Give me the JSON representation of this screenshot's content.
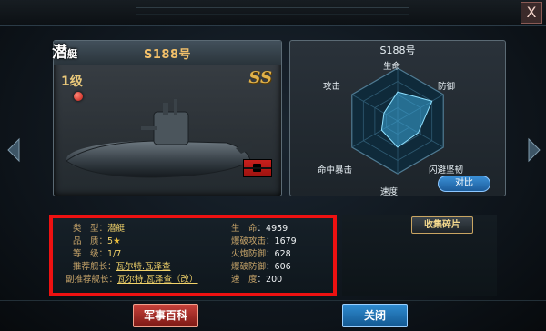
{
  "window": {
    "close_glyph": "X"
  },
  "ship": {
    "class_big": "潜",
    "class_small": "艇",
    "name": "S188号",
    "level": "1级",
    "grade": "SS",
    "icons": [
      "red-dot-icon",
      "flag-icon",
      "submarine-image"
    ]
  },
  "radar": {
    "title": "S188号",
    "axes": {
      "top": "生命",
      "top_right": "防御",
      "bottom_right": "闪避坚韧",
      "bottom": "速度",
      "bottom_left": "命中暴击",
      "top_left": "攻击"
    },
    "compare_label": "对比",
    "values": {
      "top": 0.55,
      "top_right": 0.75,
      "bottom_right": 0.45,
      "bottom": 0.5,
      "bottom_left": 0.35,
      "top_left": 0.3
    },
    "accent": "#3aa6d8"
  },
  "info": {
    "type_label": "类　型：",
    "type_value": "潜艇",
    "quality_label": "品　质：",
    "quality_value": "5",
    "rank_label": "等　级：",
    "rank_value": "1/7",
    "rec_cmd_label": "推荐舰长：",
    "rec_cmd_value": "瓦尔特.瓦泽查",
    "rec_vice_label": "副推荐舰长：",
    "rec_vice_value": "瓦尔特.瓦泽查（改）",
    "hp_label": "生　命",
    "hp_value": "4959",
    "burst_atk_label": "爆破攻击",
    "burst_atk_value": "1679",
    "fire_def_label": "火炮防御",
    "fire_def_value": "628",
    "burst_def_label": "爆破防御",
    "burst_def_value": "606",
    "speed_label": "速　度",
    "speed_value": "200"
  },
  "buttons": {
    "collect": "收集碎片",
    "encyclopedia": "军事百科",
    "close": "关闭"
  },
  "colors": {
    "highlight_border": "#ee1111",
    "gold": "#f2d36a",
    "label": "#c8a56a"
  }
}
